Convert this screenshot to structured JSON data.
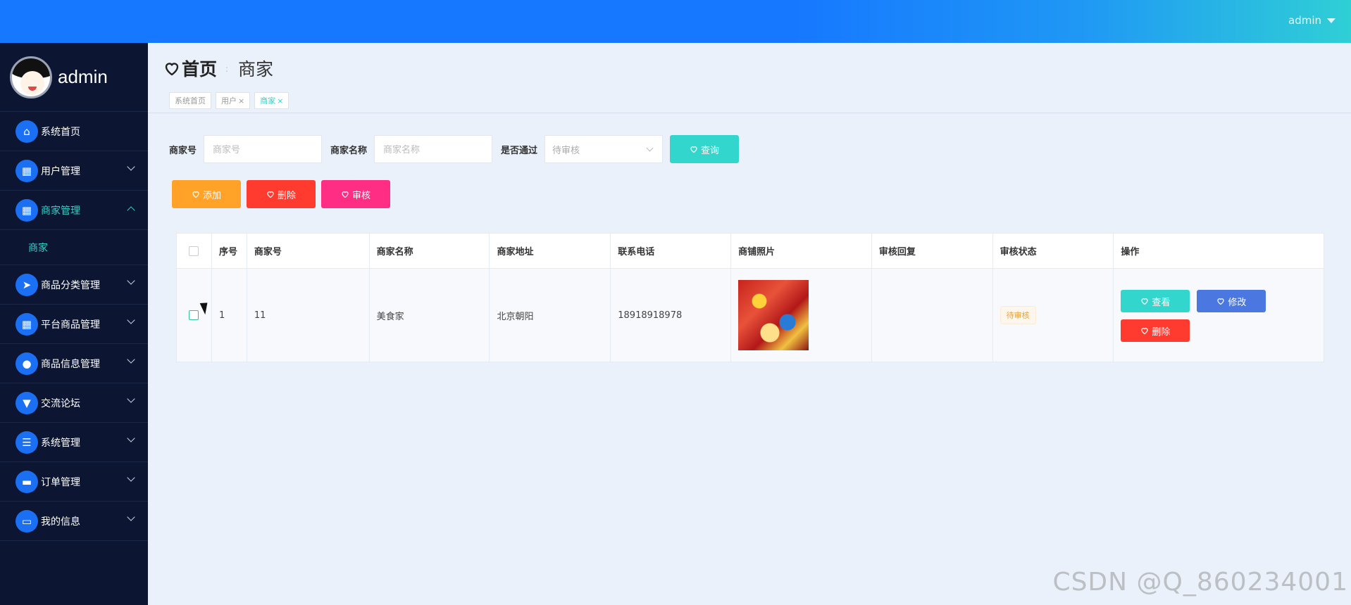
{
  "topbar": {
    "user": "admin"
  },
  "sidebar": {
    "username": "admin",
    "items": [
      {
        "label": "系统首页",
        "icon": "home-icon",
        "expandable": false
      },
      {
        "label": "用户管理",
        "icon": "grid-icon",
        "expandable": true
      },
      {
        "label": "商家管理",
        "icon": "grid-icon",
        "expandable": true,
        "active": true,
        "children": [
          "商家"
        ]
      },
      {
        "label": "商品分类管理",
        "icon": "paper-plane-icon",
        "expandable": true
      },
      {
        "label": "平台商品管理",
        "icon": "grid-icon",
        "expandable": true
      },
      {
        "label": "商品信息管理",
        "icon": "user-icon",
        "expandable": true
      },
      {
        "label": "交流论坛",
        "icon": "pin-icon",
        "expandable": true
      },
      {
        "label": "系统管理",
        "icon": "list-icon",
        "expandable": true
      },
      {
        "label": "订单管理",
        "icon": "ticket-icon",
        "expandable": true
      },
      {
        "label": "我的信息",
        "icon": "wallet-icon",
        "expandable": true
      }
    ]
  },
  "page": {
    "title": "首页",
    "separator": ":",
    "subtitle": "商家",
    "tabs": [
      {
        "label": "系统首页",
        "closable": false,
        "active": false
      },
      {
        "label": "用户",
        "closable": true,
        "active": false
      },
      {
        "label": "商家",
        "closable": true,
        "active": true
      }
    ]
  },
  "search": {
    "merchant_no_label": "商家号",
    "merchant_no_placeholder": "商家号",
    "merchant_name_label": "商家名称",
    "merchant_name_placeholder": "商家名称",
    "approved_label": "是否通过",
    "approved_value": "待审核",
    "query_button": "查询"
  },
  "actions": {
    "add": "添加",
    "delete": "删除",
    "review": "审核"
  },
  "table": {
    "columns": [
      "序号",
      "商家号",
      "商家名称",
      "商家地址",
      "联系电话",
      "商铺照片",
      "审核回复",
      "审核状态",
      "操作"
    ],
    "rows": [
      {
        "index": "1",
        "merchant_no": "11",
        "merchant_name": "美食家",
        "address": "北京朝阳",
        "phone": "18918918978",
        "reply": "",
        "status": "待审核",
        "ops": {
          "view": "查看",
          "edit": "修改",
          "delete": "删除"
        }
      }
    ]
  },
  "colors": {
    "topbar": "#1677ff",
    "sidebar": "#0c1633",
    "accent": "#33d0c6",
    "orange": "#ffa227",
    "red": "#ff3b30",
    "pink": "#ff2d84",
    "blue": "#4a78e0"
  },
  "watermark": "CSDN @Q_860234001"
}
